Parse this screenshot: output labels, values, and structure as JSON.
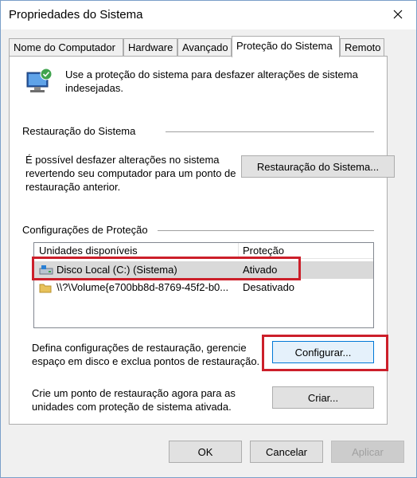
{
  "window": {
    "title": "Propriedades do Sistema"
  },
  "tabs": [
    {
      "label": "Nome do Computador"
    },
    {
      "label": "Hardware"
    },
    {
      "label": "Avançado"
    },
    {
      "label": "Proteção do Sistema"
    },
    {
      "label": "Remoto"
    }
  ],
  "intro": {
    "text": "Use a proteção do sistema para desfazer alterações de sistema indesejadas."
  },
  "restore": {
    "section_label": "Restauração do Sistema",
    "text": "É possível desfazer alterações no sistema revertendo seu computador para um ponto de restauração anterior.",
    "button_label": "Restauração do Sistema..."
  },
  "protection": {
    "section_label": "Configurações de Proteção",
    "columns": [
      "Unidades disponíveis",
      "Proteção"
    ],
    "rows": [
      {
        "drive": "Disco Local (C:) (Sistema)",
        "status": "Ativado",
        "icon": "system-drive-icon"
      },
      {
        "drive": "\\\\?\\Volume{e700bb8d-8769-45f2-b0...",
        "status": "Desativado",
        "icon": "folder-drive-icon"
      }
    ],
    "configure_text": "Defina configurações de restauração, gerencie espaço em disco e exclua pontos de restauração.",
    "configure_button": "Configurar...",
    "create_text": "Crie um ponto de restauração agora para as unidades com proteção de sistema ativada.",
    "create_button": "Criar..."
  },
  "footer": {
    "ok": "OK",
    "cancel": "Cancelar",
    "apply": "Aplicar"
  },
  "colors": {
    "highlight_box": "#cc1f2a",
    "focus_border": "#0078d7"
  }
}
